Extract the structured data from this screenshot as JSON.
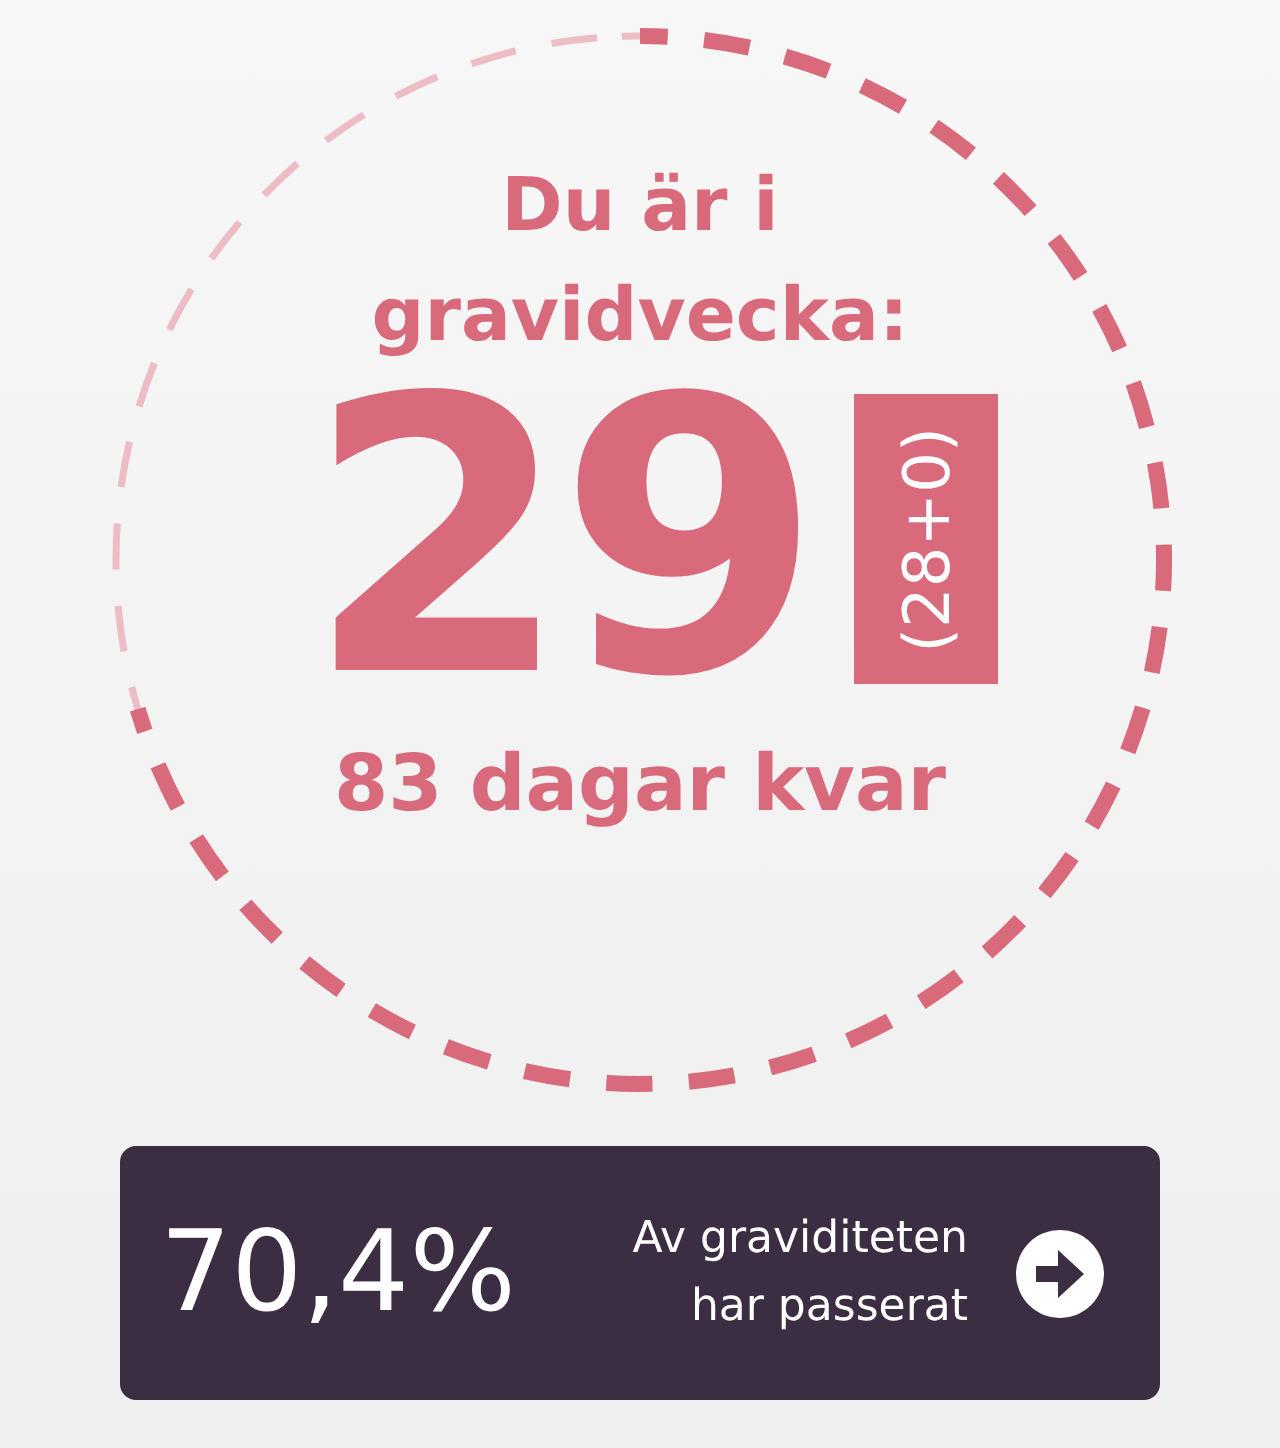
{
  "week_ring": {
    "heading": "Du är i gravidvecka:",
    "week": "29",
    "week_detail": "(28+0)",
    "days_left": "83 dagar kvar"
  },
  "progress_card": {
    "percent": "70,4%",
    "caption": "Av graviditeten har passerat"
  }
}
